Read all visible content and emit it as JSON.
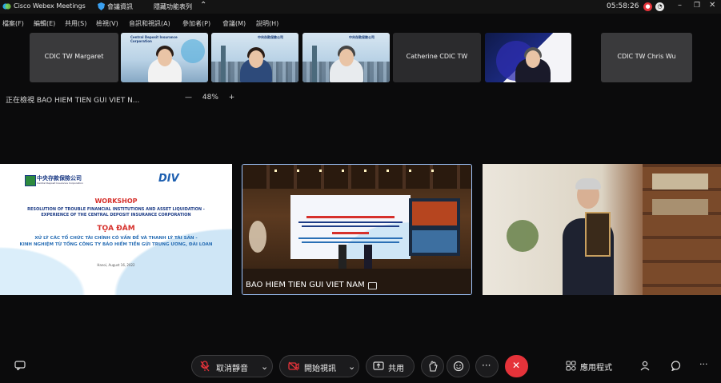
{
  "app": {
    "title": "Cisco Webex Meetings",
    "meeting_info": "會議資訊",
    "hide_menu": "隱藏功能表列",
    "clock": "05:58:26",
    "menu": [
      "檔案(F)",
      "編輯(E)",
      "共用(S)",
      "檢視(V)",
      "音訊和視訊(A)",
      "參加者(P)",
      "會議(M)",
      "說明(H)"
    ]
  },
  "thumbnails": [
    {
      "kind": "name",
      "label": "CDIC TW Margaret"
    },
    {
      "kind": "video",
      "tag": "Central Deposit Insurance Corporation"
    },
    {
      "kind": "video",
      "tag": "中央存款保險公司"
    },
    {
      "kind": "video",
      "tag": "中央存款保險公司"
    },
    {
      "kind": "name",
      "label": "Catherine CDIC TW"
    },
    {
      "kind": "video",
      "tag": ""
    },
    {
      "kind": "name",
      "label": "CDIC TW Chris Wu"
    }
  ],
  "viewing": {
    "label": "正在檢視 BAO HIEM TIEN GUI VIET N...",
    "minus": "—",
    "zoom": "48%",
    "plus": "+"
  },
  "slide": {
    "org": "中央存款保險公司",
    "org_en": "Central Deposit Insurance Corporation",
    "logo": "DIV",
    "workshop": "WORKSHOP",
    "en_line1": "RESOLUTION OF TROUBLE FINANCIAL INSTITUTIONS AND ASSET LIQUIDATION -",
    "en_line2": "EXPERIENCE OF THE CENTRAL DEPOSIT INSURANCE CORPORATION",
    "vi_title": "TỌA ĐÀM",
    "vi_line1": "XỬ LÝ CÁC TỔ CHỨC TÀI CHÍNH CÓ VẤN ĐỀ VÀ THANH LÝ TÀI SẢN -",
    "vi_line2": "KINH NGHIỆM TỪ TỔNG CÔNG TY BẢO HIỂM TIỀN GỬI TRUNG ƯƠNG, ĐÀI LOAN",
    "date": "Hanoi, August 16, 2022"
  },
  "stage": {
    "caption": "BAO HIEM TIEN GUI VIET NAM"
  },
  "toolbar": {
    "mute": "取消靜音",
    "video": "開始視訊",
    "share": "共用",
    "apps": "應用程式"
  },
  "colors": {
    "background": "#0b0b0c",
    "end_button": "#e5333a",
    "selected_border": "#9ec6ff",
    "slide_red": "#d6302b",
    "slide_blue": "#1d3c86"
  }
}
